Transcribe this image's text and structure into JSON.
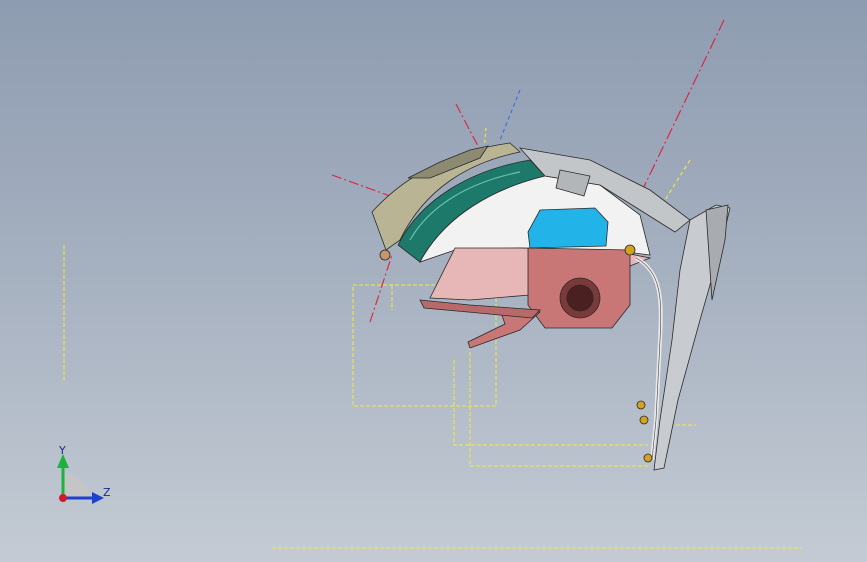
{
  "viewport": {
    "colors": {
      "bg_top": "#8e9cb1",
      "bg_bottom": "#c4cbd4",
      "datum_yellow": "#f2ec3c",
      "red_axis": "#e0203a",
      "blue_axis": "#3a6ee0",
      "part_pink": "#c87676",
      "part_teal": "#1d7a6a",
      "part_cyan": "#22b4e8",
      "part_khaki": "#b9b594"
    }
  },
  "triad": {
    "y_label": "Y",
    "z_label": "Z",
    "icons": [
      "y-axis-arrow-icon",
      "z-axis-arrow-icon",
      "origin-dot-icon"
    ]
  }
}
